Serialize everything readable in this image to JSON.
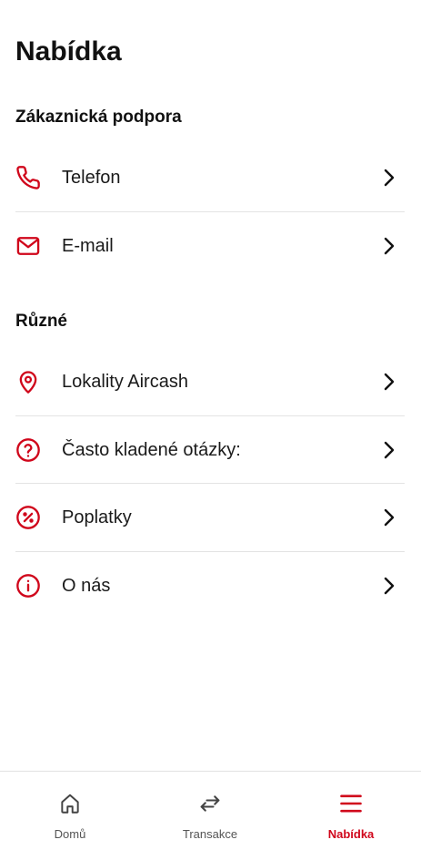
{
  "page": {
    "title": "Nabídka"
  },
  "colors": {
    "accent": "#d0061b",
    "text": "#111111",
    "divider": "#e3e3e3"
  },
  "sections": [
    {
      "title": "Zákaznická podpora",
      "items": [
        {
          "label": "Telefon",
          "icon": "phone-icon"
        },
        {
          "label": "E-mail",
          "icon": "mail-icon"
        }
      ]
    },
    {
      "title": "Různé",
      "items": [
        {
          "label": "Lokality Aircash",
          "icon": "location-pin-icon"
        },
        {
          "label": "Často kladené otázky:",
          "icon": "question-circle-icon"
        },
        {
          "label": "Poplatky",
          "icon": "percent-circle-icon"
        },
        {
          "label": "O nás",
          "icon": "info-circle-icon"
        }
      ]
    }
  ],
  "bottom_nav": {
    "items": [
      {
        "label": "Domů",
        "icon": "home-icon",
        "active": false
      },
      {
        "label": "Transakce",
        "icon": "transfer-arrows-icon",
        "active": false
      },
      {
        "label": "Nabídka",
        "icon": "menu-icon",
        "active": true
      }
    ]
  }
}
